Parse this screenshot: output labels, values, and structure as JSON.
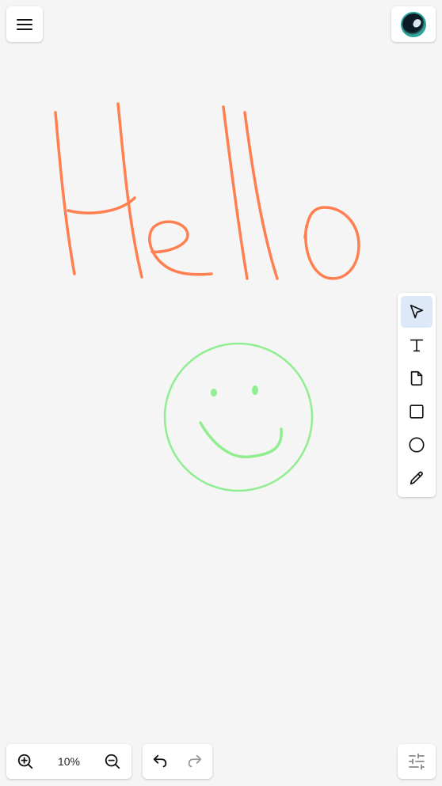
{
  "canvas": {
    "drawings": [
      {
        "name": "hello-handwriting",
        "color": "#ff7f50"
      },
      {
        "name": "smiley-face",
        "color": "#90ee90"
      }
    ]
  },
  "header": {
    "menu_icon": "hamburger-menu-icon",
    "avatar_icon": "user-avatar"
  },
  "toolbar": {
    "tools": [
      {
        "id": "select",
        "icon": "cursor-arrow-icon",
        "active": true
      },
      {
        "id": "text",
        "icon": "text-t-icon",
        "active": false
      },
      {
        "id": "sticky-note",
        "icon": "sticky-note-icon",
        "active": false
      },
      {
        "id": "rectangle",
        "icon": "square-icon",
        "active": false
      },
      {
        "id": "ellipse",
        "icon": "circle-icon",
        "active": false
      },
      {
        "id": "pen",
        "icon": "pencil-icon",
        "active": false
      }
    ],
    "active_color": "#dde8f8"
  },
  "zoom": {
    "value": "10%",
    "zoom_in_icon": "zoom-in-icon",
    "zoom_out_icon": "zoom-out-icon"
  },
  "history": {
    "undo_icon": "undo-icon",
    "redo_icon": "redo-icon",
    "redo_enabled": false
  },
  "settings": {
    "icon": "sliders-icon"
  }
}
